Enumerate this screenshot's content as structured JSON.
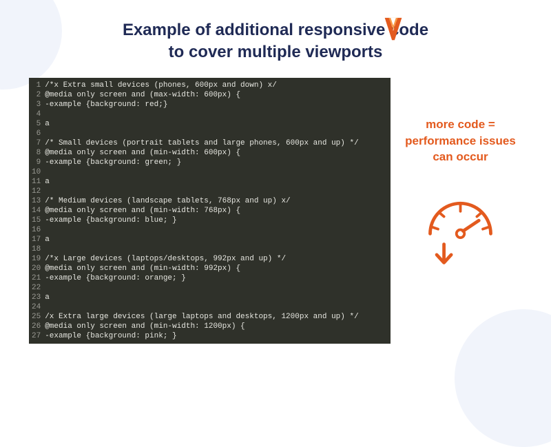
{
  "title_line1": "Example of additional responsive code",
  "title_line2": "to cover multiple viewports",
  "logo_name": "wp-rocket-logo",
  "code": {
    "lines": [
      "/*x Extra small devices (phones, 600px and down) x/",
      "@media only screen and (max-width: 600px) {",
      "-example {background: red;}",
      "",
      "a",
      "",
      "/* Small devices (portrait tablets and large phones, 600px and up) */",
      "@media only screen and (min-width: 600px) {",
      "-example {background: green; }",
      "",
      "a",
      "",
      "/* Medium devices (landscape tablets, 768px and up) x/",
      "@media only screen and (min-width: 768px) {",
      "-example {background: blue; }",
      "",
      "a",
      "",
      "/*x Large devices (laptops/desktops, 992px and up) */",
      "@media only screen and (min-width: 992px) {",
      "-example {background: orange; }",
      "",
      "a",
      "",
      "/x Extra large devices (large laptops and desktops, 1200px and up) */",
      "@media only screen and (min-width: 1200px) {",
      "-example {background: pink; }"
    ]
  },
  "aside": {
    "line1": "more code =",
    "line2": "performance issues",
    "line3": "can occur"
  },
  "colors": {
    "title": "#1f2a55",
    "accent": "#e35a1e",
    "code_bg": "#2f312a"
  },
  "icon": "speedometer-down-icon"
}
